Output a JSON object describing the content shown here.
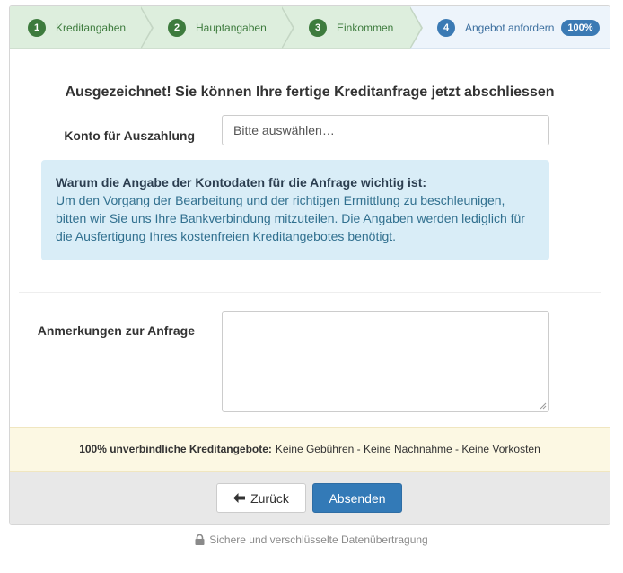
{
  "steps": [
    {
      "number": "1",
      "label": "Kreditangaben"
    },
    {
      "number": "2",
      "label": "Hauptangaben"
    },
    {
      "number": "3",
      "label": "Einkommen"
    },
    {
      "number": "4",
      "label": "Angebot anfordern",
      "badge": "100%"
    }
  ],
  "heading": "Ausgezeichnet! Sie können Ihre fertige Kreditanfrage jetzt abschliessen",
  "konto": {
    "label": "Konto für Auszahlung",
    "selected": "Bitte auswählen…"
  },
  "info": {
    "title": "Warum die Angabe der Kontodaten für die Anfrage wichtig ist:",
    "text": "Um den Vorgang der Bearbeitung und der richtigen Ermittlung zu beschleunigen, bitten wir Sie uns Ihre Bankverbindung mitzuteilen. Die Angaben werden lediglich für die Ausfertigung Ihres kostenfreien Kreditangebotes benötigt."
  },
  "anmerkungen": {
    "label": "Anmerkungen zur Anfrage",
    "value": ""
  },
  "notice": {
    "bold": "100% unverbindliche Kreditangebote:",
    "text": "Keine Gebühren - Keine Nachnahme - Keine Vorkosten"
  },
  "buttons": {
    "back": "Zurück",
    "back_icon": "arrow-left-icon",
    "submit": "Absenden"
  },
  "secure": {
    "icon": "lock-icon",
    "text": "Sichere und verschlüsselte Datenübertragung"
  },
  "colors": {
    "step_done": "#3d7b3d",
    "step_active": "#3b7ab4",
    "primary_button": "#337ab7",
    "info_bg": "#d9edf7",
    "notice_bg": "#fcf8e3"
  }
}
